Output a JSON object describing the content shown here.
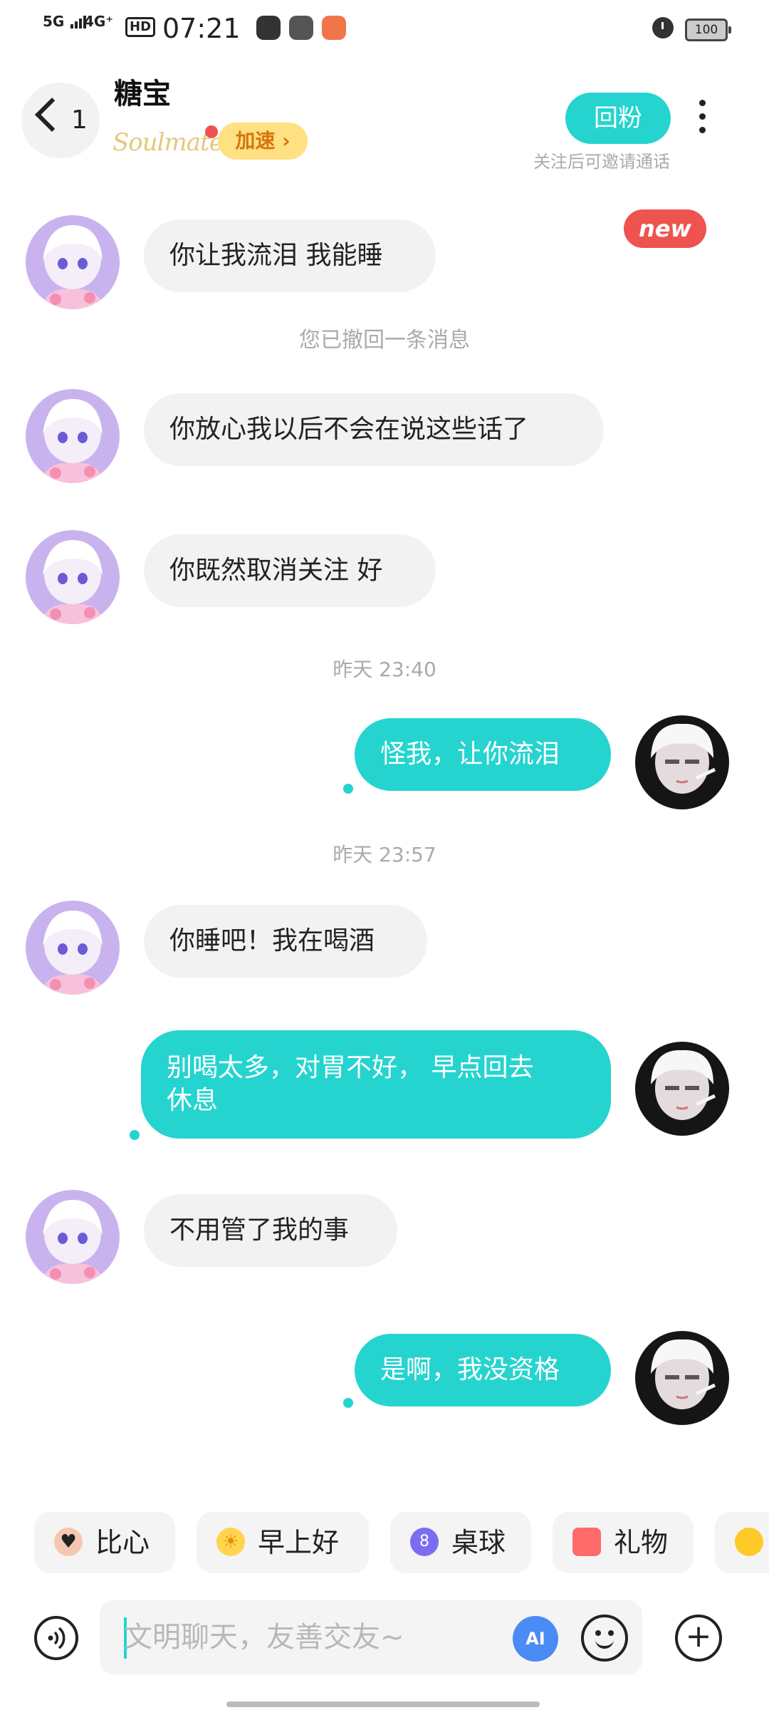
{
  "status_bar": {
    "network": "5G",
    "network2": "4G⁺",
    "hd": "HD",
    "time": "07:21",
    "battery": "100"
  },
  "header": {
    "back_count": "1",
    "name": "糖宝",
    "soulmate_logo": "Soulmate",
    "speed_label": "加速 ›",
    "follow_label": "回粉",
    "follow_hint": "关注后可邀请通话"
  },
  "new_badge": "new",
  "messages": [
    {
      "side": "in",
      "text": "你让我流泪 我能睡"
    },
    {
      "type": "system",
      "text": "您已撤回一条消息"
    },
    {
      "side": "in",
      "text": "你放心我以后不会在说这些话了"
    },
    {
      "side": "in",
      "text": "你既然取消关注 好"
    },
    {
      "type": "time",
      "text": "昨天 23:40"
    },
    {
      "side": "out",
      "text": "怪我，让你流泪"
    },
    {
      "type": "time",
      "text": "昨天 23:57"
    },
    {
      "side": "in",
      "text": "你睡吧！我在喝酒"
    },
    {
      "side": "out",
      "text": "别喝太多，对胃不好， 早点回去\n休息"
    },
    {
      "side": "in",
      "text": "不用管了我的事"
    },
    {
      "side": "out",
      "text": "是啊，我没资格"
    }
  ],
  "quick_replies": [
    {
      "label": "比心",
      "icon": "finger-heart-icon",
      "color": "#f6c7b0"
    },
    {
      "label": "早上好",
      "icon": "sun-icon",
      "color": "#ffd54f"
    },
    {
      "label": "桌球",
      "icon": "billiard-ball-icon",
      "color": "#7c6df0"
    },
    {
      "label": "礼物",
      "icon": "gift-icon",
      "color": "#ff6b6b"
    }
  ],
  "input": {
    "placeholder": "文明聊天，友善交友~",
    "ai_label": "AI"
  },
  "colors": {
    "accent": "#25d4cf",
    "incoming_bubble": "#f2f2f2",
    "badge_red": "#ef5350"
  }
}
